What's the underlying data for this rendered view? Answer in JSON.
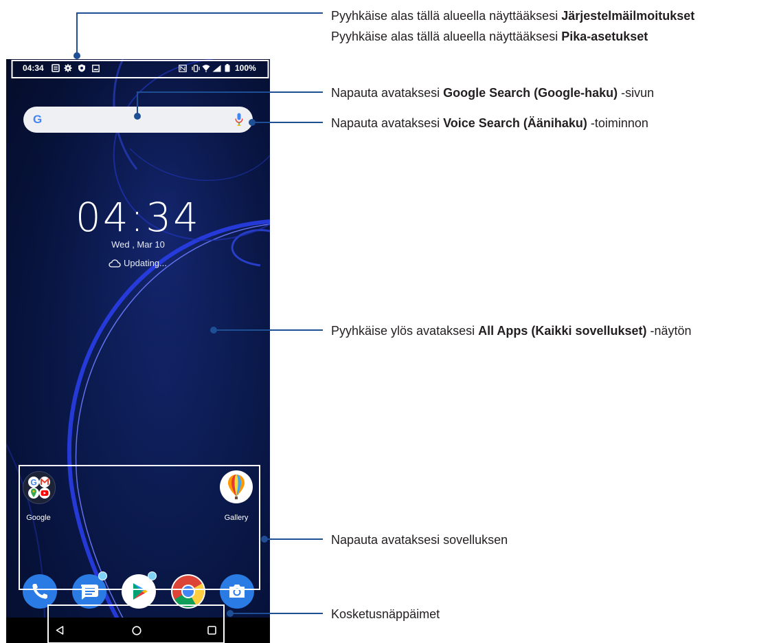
{
  "status_bar": {
    "time": "04:34",
    "battery": "100%"
  },
  "search": {
    "logo": "G",
    "mic_icon": "mic-icon"
  },
  "lock": {
    "clock": "04:34",
    "date": "Wed , Mar 10",
    "weather": "Updating..."
  },
  "apps": {
    "google_folder_label": "Google",
    "gallery_label": "Gallery",
    "dock": [
      {
        "name": "phone",
        "color": "#2b7be5"
      },
      {
        "name": "messages",
        "color": "#2b7be5"
      },
      {
        "name": "play-store",
        "color": "#ffffff"
      },
      {
        "name": "chrome",
        "color": "#ffffff"
      },
      {
        "name": "camera",
        "color": "#2b7be5"
      }
    ]
  },
  "callouts": {
    "notifications": {
      "pre": "Pyyhkäise alas tällä alueella näyttääksesi ",
      "bold": "Järjestelmäilmoitukset",
      "post": ""
    },
    "quick_settings": {
      "pre": "Pyyhkäise alas tällä alueella näyttääksesi ",
      "bold": "Pika-asetukset",
      "post": ""
    },
    "google_search": {
      "pre": "Napauta avataksesi ",
      "bold": "Google Search (Google-haku)",
      "post": " -sivun"
    },
    "voice_search": {
      "pre": "Napauta avataksesi ",
      "bold": "Voice Search (Äänihaku)",
      "post": " -toiminnon"
    },
    "all_apps": {
      "pre": "Pyyhkäise ylös avataksesi ",
      "bold": "All Apps (Kaikki sovellukset)",
      "post": " -näytön"
    },
    "open_app": {
      "pre": "Napauta avataksesi sovelluksen",
      "bold": "",
      "post": ""
    },
    "nav_keys": {
      "pre": "Kosketusnäppäimet",
      "bold": "",
      "post": ""
    }
  },
  "colors": {
    "annotation_line": "#1e4f94",
    "highlight_box": "#ffffff",
    "wallpaper_accent": "#1f3ad0"
  }
}
